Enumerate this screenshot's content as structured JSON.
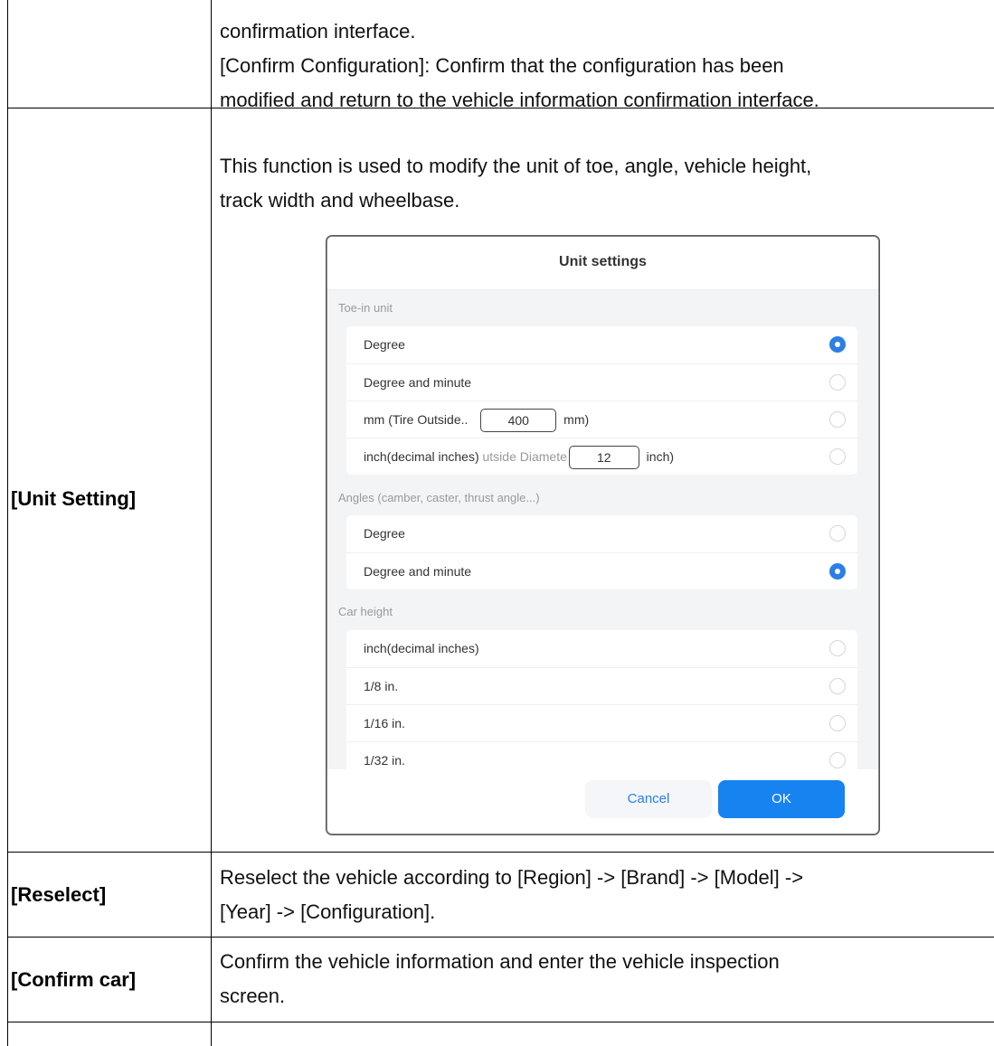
{
  "row1": {
    "line1": "confirmation interface.",
    "line2": "[Confirm Configuration]: Confirm that the configuration has been",
    "line3": "modified and return to the vehicle information confirmation interface."
  },
  "row2": {
    "label": "[Unit Setting]",
    "desc_line1": "This function is used to modify the unit of toe, angle, vehicle height,",
    "desc_line2": "track width and wheelbase."
  },
  "dialog": {
    "title": "Unit settings",
    "sections": [
      {
        "label": "Toe-in unit",
        "options": [
          {
            "label": "Degree",
            "selected": true
          },
          {
            "label": "Degree and minute",
            "selected": false
          },
          {
            "prefix": "mm (Tire Outside..",
            "value": "400",
            "suffix": "mm)",
            "selected": false
          },
          {
            "prefix": "inch(decimal inches)",
            "faded": "utside Diamete",
            "value": "12",
            "suffix": "inch)",
            "selected": false
          }
        ]
      },
      {
        "label": "Angles (camber, caster, thrust angle...)",
        "options": [
          {
            "label": "Degree",
            "selected": false
          },
          {
            "label": "Degree and minute",
            "selected": true
          }
        ]
      },
      {
        "label": "Car height",
        "options": [
          {
            "label": "inch(decimal inches)",
            "selected": false
          },
          {
            "label": "1/8 in.",
            "selected": false
          },
          {
            "label": "1/16 in.",
            "selected": false
          },
          {
            "label": "1/32 in.",
            "selected": false
          }
        ]
      }
    ],
    "cancel_label": "Cancel",
    "ok_label": "OK",
    "accent_color": "#1683f0"
  },
  "row3": {
    "label": "[Reselect]",
    "line1": "Reselect the vehicle according to [Region] -> [Brand] -> [Model] ->",
    "line2": "[Year] -> [Configuration]."
  },
  "row4": {
    "label": "[Confirm car]",
    "line1": "Confirm the vehicle information and enter the vehicle inspection",
    "line2": "screen."
  }
}
